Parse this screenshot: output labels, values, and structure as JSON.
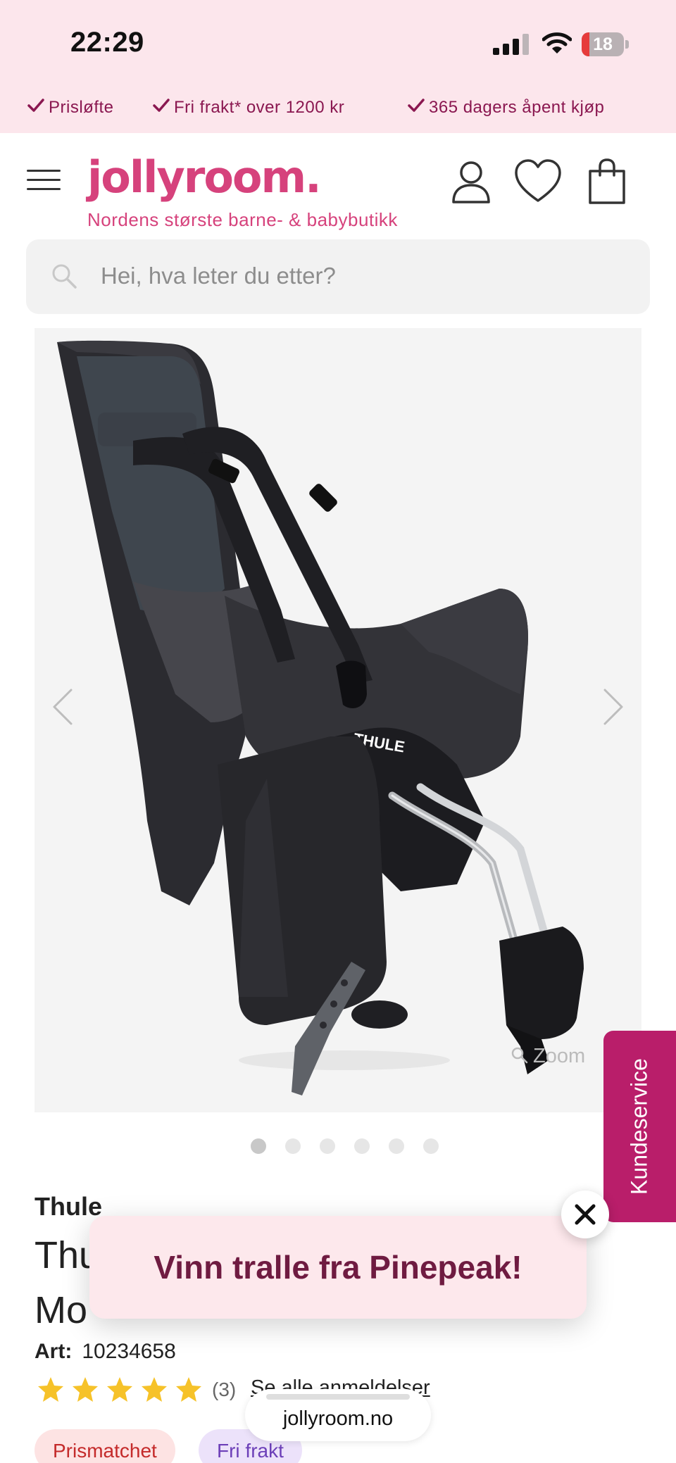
{
  "status_bar": {
    "time": "22:29",
    "battery": "18",
    "battery_level": 0.18,
    "battery_color": "#e63b3b"
  },
  "usp_bar": {
    "items": [
      "Prisløfte",
      "Fri frakt* over 1200 kr",
      "365 dagers åpent kjøp"
    ]
  },
  "header": {
    "logo": "jollyroom.",
    "tagline": "Nordens største barne- & babybutikk",
    "icons": [
      "menu-icon",
      "account-icon",
      "wishlist-heart-icon",
      "shopping-bag-icon"
    ]
  },
  "search": {
    "placeholder": "Hei, hva leter du etter?"
  },
  "gallery": {
    "brand_mark": "THULE",
    "zoom_label": "Zoom",
    "image_count": 6,
    "active_index": 0
  },
  "side_tab": {
    "label": "Kundeservice"
  },
  "product": {
    "brand": "Thule",
    "title_line1": "Thu",
    "title_line2": "Mo",
    "art_label": "Art:",
    "art_number": "10234658",
    "rating": 5,
    "review_count": "(3)",
    "review_link": "Se alle anmeldelser"
  },
  "badges": [
    "Prismatchet",
    "Fri frakt"
  ],
  "promo": {
    "text": "Vinn tralle fra Pinepeak!"
  },
  "browser": {
    "url": "jollyroom.no"
  },
  "colors": {
    "brand_pink": "#d6427c",
    "side_tab": "#b91e6a",
    "promo_text": "#6f1b41",
    "star": "#f6c229",
    "usp_text": "#8a1750"
  }
}
